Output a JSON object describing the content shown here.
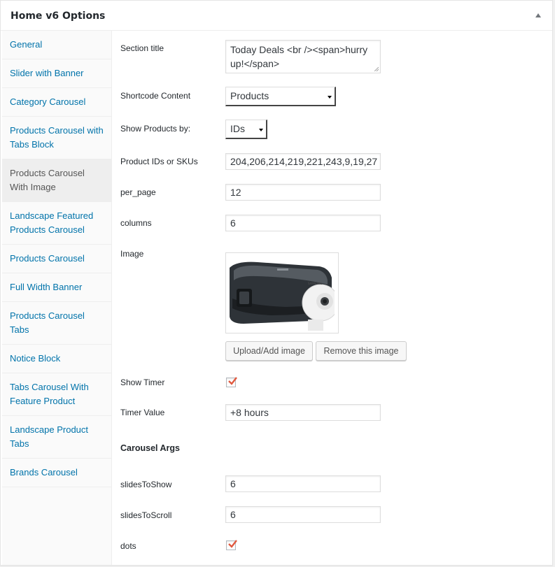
{
  "postbox": {
    "title": "Home v6 Options"
  },
  "colors": {
    "link": "#0073aa",
    "checkbox_mark": "#e0593f",
    "active_tab_bg": "#eeeeee"
  },
  "icons": {
    "toggle": "triangle-up-icon",
    "checkbox": "checkmark-icon",
    "select": "dropdown-arrow-icon"
  },
  "tabs": [
    {
      "label": "General"
    },
    {
      "label": "Slider with Banner"
    },
    {
      "label": "Category Carousel"
    },
    {
      "label": "Products Carousel with Tabs Block"
    },
    {
      "label": "Products Carousel With Image",
      "active": true
    },
    {
      "label": "Landscape Featured Products Carousel"
    },
    {
      "label": "Products Carousel"
    },
    {
      "label": "Full Width Banner"
    },
    {
      "label": "Products Carousel Tabs"
    },
    {
      "label": "Notice Block"
    },
    {
      "label": "Tabs Carousel With Feature Product"
    },
    {
      "label": "Landscape Product Tabs"
    },
    {
      "label": "Brands Carousel"
    }
  ],
  "fields": {
    "section_title": {
      "label": "Section title",
      "value": "Today Deals <br /><span>hurry up!</span>"
    },
    "shortcode_content": {
      "label": "Shortcode Content",
      "value": "Products"
    },
    "show_products_by": {
      "label": "Show Products by:",
      "value": "IDs"
    },
    "product_ids": {
      "label": "Product IDs or SKUs",
      "value": "204,206,214,219,221,243,9,19,27"
    },
    "per_page": {
      "label": "per_page",
      "value": "12"
    },
    "columns": {
      "label": "columns",
      "value": "6"
    },
    "image": {
      "label": "Image",
      "upload_label": "Upload/Add image",
      "remove_label": "Remove this image"
    },
    "show_timer": {
      "label": "Show Timer",
      "checked": true
    },
    "timer_value": {
      "label": "Timer Value",
      "value": "+8 hours"
    }
  },
  "carousel_args": {
    "heading": "Carousel Args",
    "slides_to_show": {
      "label": "slidesToShow",
      "value": "6"
    },
    "slides_to_scroll": {
      "label": "slidesToScroll",
      "value": "6"
    },
    "dots": {
      "label": "dots",
      "checked": true
    }
  }
}
